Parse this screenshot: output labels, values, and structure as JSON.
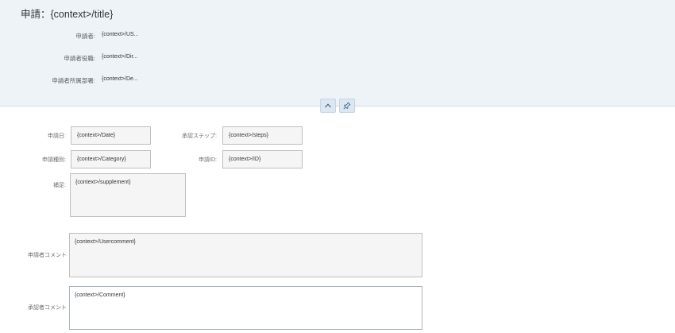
{
  "header": {
    "title": "申請：{context>/title}",
    "fields": [
      {
        "label": "申請者:",
        "value": "{context>/US..."
      },
      {
        "label": "申請者役職:",
        "value": "{context>/Dir..."
      },
      {
        "label": "申請者所属部署:",
        "value": "{context>/De..."
      }
    ],
    "collapse_icon": "chevron-up-icon",
    "pin_icon": "pin-icon"
  },
  "form": {
    "date": {
      "label": "申請日:",
      "value": "{context>/Date}"
    },
    "steps": {
      "label": "承認ステップ:",
      "value": "{context>/steps}"
    },
    "category": {
      "label": "申請種別:",
      "value": "{context>/Category}"
    },
    "id": {
      "label": "申請ID:",
      "value": "{context>/ID}"
    },
    "supplement": {
      "label": "補足:",
      "value": "{context>/supplement}"
    },
    "user_comment": {
      "label": "申請者コメント",
      "value": "{context>/Usercomment}"
    },
    "approver_comment": {
      "label": "承認者コメント",
      "value": "{context>/Comment}"
    }
  }
}
